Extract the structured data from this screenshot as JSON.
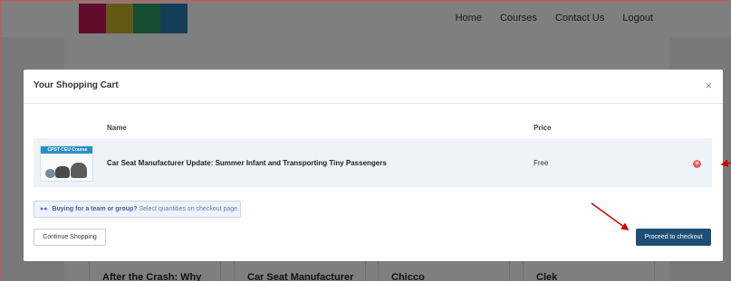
{
  "nav": {
    "items": [
      "Home",
      "Courses",
      "Contact Us",
      "Logout"
    ]
  },
  "background_cards": [
    "After the Crash: Why Size",
    "Car Seat Manufacturer",
    "Chicco",
    "Clek"
  ],
  "modal": {
    "title": "Your Shopping Cart",
    "close_glyph": "×",
    "columns": {
      "name": "Name",
      "price": "Price"
    },
    "item": {
      "thumbnail_tag": "CPST CEU Course",
      "name": "Car Seat Manufacturer Update: Summer Infant and Transporting Tiny Passengers",
      "price": "Free",
      "remove_glyph": "×"
    },
    "group_notice": {
      "icon": "users-icon",
      "bold": "Buying for a team or group?",
      "rest": "Select quantities on checkout page."
    },
    "continue_label": "Continue Shopping",
    "checkout_label": "Proceed to checkout"
  },
  "colors": {
    "accent": "#1d4f76",
    "annotation_arrow": "#cc0000",
    "remove": "#e45f5f"
  }
}
